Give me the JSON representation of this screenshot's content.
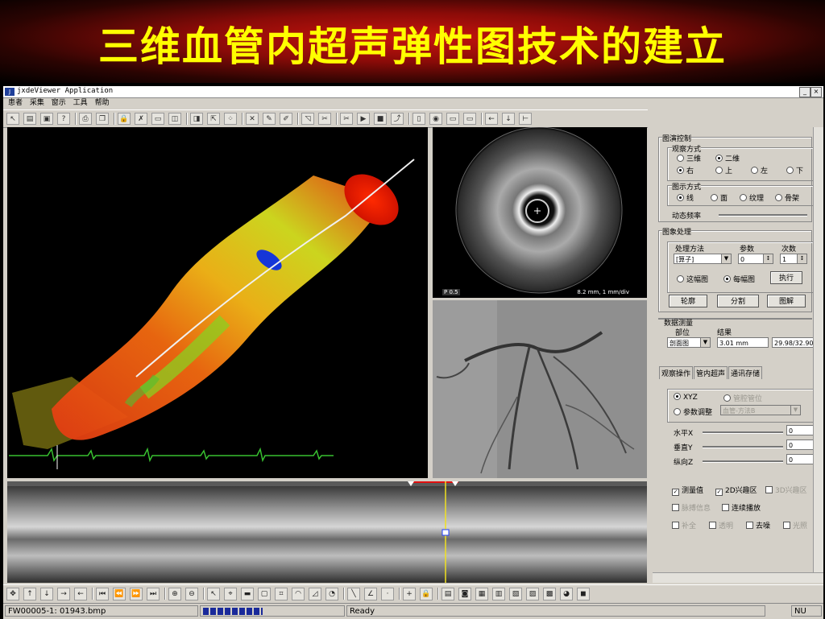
{
  "banner": {
    "title": "三维血管内超声弹性图技术的建立"
  },
  "window": {
    "title": "jxdeViewer Application",
    "menu": [
      "患者",
      "采集",
      "窗示",
      "工具",
      "帮助"
    ]
  },
  "ivus": {
    "label_left": "P 0.5",
    "label_right": "8.2 mm, 1 mm/div"
  },
  "panel": {
    "display_control": {
      "title": "图演控制",
      "view_mode": {
        "title": "观察方式",
        "options": [
          "三维",
          "二维"
        ],
        "selected": "二维"
      },
      "direction": {
        "options": [
          "右",
          "上",
          "左",
          "下"
        ],
        "selected": "右"
      },
      "render_mode": {
        "title": "图示方式",
        "options": [
          "线",
          "面",
          "纹理",
          "骨架"
        ],
        "selected": "线"
      },
      "anim_label": "动态频率"
    },
    "image_process": {
      "title": "图象处理",
      "col_method": "处理方法",
      "col_param": "参数",
      "col_times": "次数",
      "method_value": "[算子]",
      "param_value": "0",
      "times_value": "1",
      "scope_this": "这幅图",
      "scope_each": "每幅图",
      "scope_selected": "每幅图",
      "execute": "执行",
      "buttons": [
        "轮廓",
        "分割",
        "图解"
      ]
    },
    "measure": {
      "title": "数据测量",
      "col_part": "部位",
      "col_result": "结果",
      "part_value": "剖面图",
      "result_value": "3.01 mm",
      "result2": "29.98/32.90"
    },
    "tabs": [
      "观察操作",
      "管内超声",
      "通讯存储"
    ],
    "observe": {
      "xyz": "XYZ",
      "vessel_pos": "管腔管位",
      "param_adjust": "参数调整",
      "param_combo": "血管-方法B",
      "sliders": [
        {
          "label": "水平X",
          "value": "0"
        },
        {
          "label": "垂直Y",
          "value": "0"
        },
        {
          "label": "纵向Z",
          "value": "0"
        }
      ],
      "checks": [
        {
          "label": "测量值",
          "checked": true,
          "disabled": false
        },
        {
          "label": "2D兴趣区",
          "checked": true,
          "disabled": false
        },
        {
          "label": "3D兴趣区",
          "checked": false,
          "disabled": true
        },
        {
          "label": "脉搏信息",
          "checked": false,
          "disabled": true
        },
        {
          "label": "连续播放",
          "checked": false,
          "disabled": false
        },
        {
          "label": "补全",
          "checked": false,
          "disabled": true
        },
        {
          "label": "透明",
          "checked": false,
          "disabled": true
        },
        {
          "label": "去噪",
          "checked": false,
          "disabled": false
        },
        {
          "label": "光照",
          "checked": false,
          "disabled": true
        }
      ]
    }
  },
  "status": {
    "file": "FW00005-1: 01943.bmp",
    "state": "Ready",
    "mode": "NU"
  },
  "icons": {
    "toolbar": [
      "pointer",
      "open",
      "save",
      "help",
      "print",
      "copy",
      "lock",
      "cross",
      "disk",
      "window",
      "window2",
      "export",
      "dots",
      "close",
      "tool1",
      "tool2",
      "tool3",
      "cut1",
      "cut2",
      "play",
      "stop",
      "step",
      "doc",
      "camera",
      "monitor",
      "monitor2",
      "arrow-left",
      "arrow-down",
      "graph"
    ],
    "bottom": [
      "move",
      "up",
      "down",
      "right",
      "left",
      "first",
      "prev",
      "next",
      "last",
      "zoom-in",
      "zoom-out",
      "cursor",
      "pick",
      "rect",
      "rect2",
      "shape1",
      "shape2",
      "shape3",
      "shape4",
      "line",
      "angle",
      "dot",
      "plus",
      "lock",
      "b1",
      "b2",
      "b3",
      "b4",
      "b5",
      "b6",
      "b7",
      "b8",
      "b9"
    ]
  }
}
